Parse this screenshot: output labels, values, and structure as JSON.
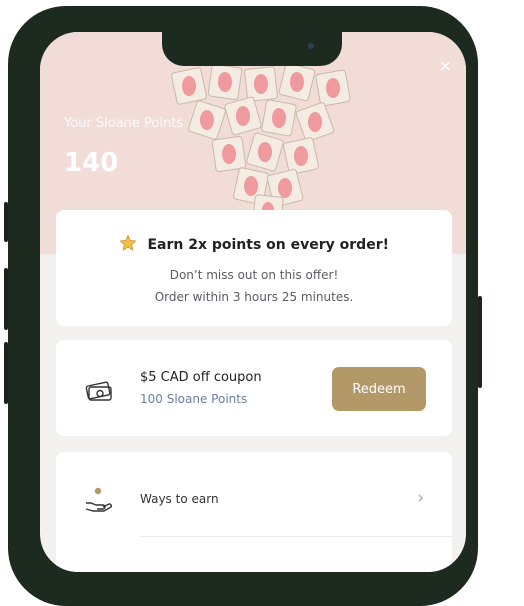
{
  "points": {
    "label": "Your Sloane Points",
    "value": "140"
  },
  "offer": {
    "title": "Earn 2x points on every order!",
    "line1": "Don’t miss out on this offer!",
    "line2": "Order within 3 hours 25 minutes.",
    "icon": "star-icon"
  },
  "coupon": {
    "title": "$5 CAD off coupon",
    "subtitle": "100 Sloane Points",
    "button": "Redeem",
    "icon": "money-icon"
  },
  "earn": {
    "label": "Ways to earn",
    "icon": "hand-coin-icon"
  },
  "close_icon": "×",
  "colors": {
    "hero_bg": "#f2dcd7",
    "accent": "#b49968",
    "link": "#6a7fa0",
    "frame": "#1d2a1f"
  }
}
